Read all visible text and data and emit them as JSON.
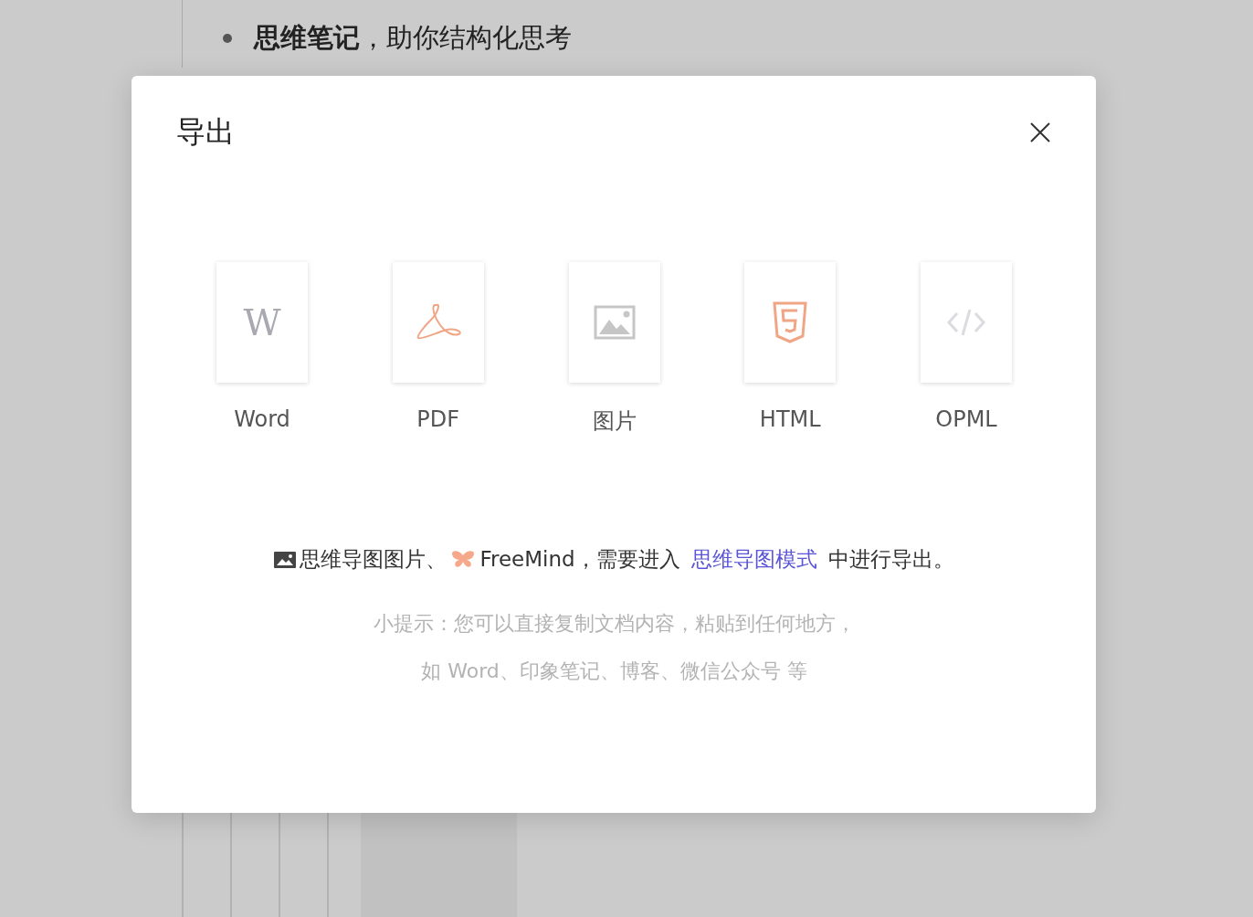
{
  "document": {
    "bullet_item": "**思维笔记**，助你结构化思考"
  },
  "dialog": {
    "title": "导出",
    "formats": [
      {
        "kind": "word",
        "label": "Word",
        "icon_glyph": "W"
      },
      {
        "kind": "pdf",
        "label": "PDF"
      },
      {
        "kind": "image",
        "label": "图片"
      },
      {
        "kind": "html",
        "label": "HTML"
      },
      {
        "kind": "opml",
        "label": "OPML"
      }
    ],
    "note": {
      "part_1": "思维导图图片、",
      "part_2": "FreeMind，需要进入",
      "link": "思维导图模式",
      "part_3": "中进行导出。"
    },
    "tips": [
      "小提示：您可以直接复制文档内容，粘贴到任何地方，",
      "如 Word、印象笔记、博客、微信公众号 等"
    ]
  }
}
